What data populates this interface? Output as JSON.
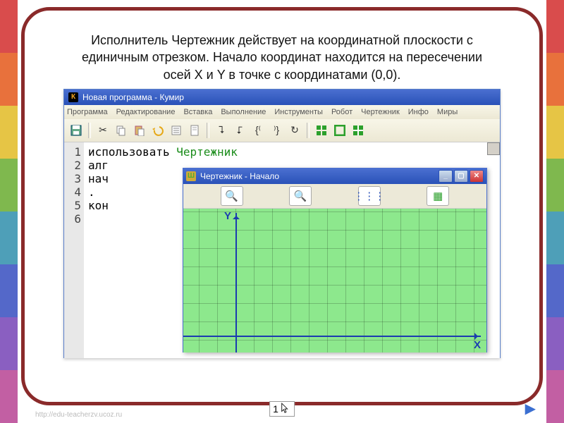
{
  "headline": "Исполнитель Чертежник действует на координатной плоскости с единичным отрезком. Начало координат находится на пересечении осей X и Y  в точке с координатами (0,0).",
  "kumir": {
    "title": "Новая программа - Кумир",
    "title_badge": "К",
    "menu": [
      "Программа",
      "Редактирование",
      "Вставка",
      "Выполнение",
      "Инструменты",
      "Робот",
      "Чертежник",
      "Инфо",
      "Миры"
    ],
    "code": {
      "line1a": "использовать ",
      "line1b": "Чертежник",
      "line2": "алг",
      "line3": "нач",
      "line4": ".",
      "line5": "кон",
      "gutters": [
        1,
        2,
        3,
        4,
        5,
        6
      ]
    }
  },
  "drawer": {
    "title": "Чертежник - Начало",
    "title_badge": "Ш",
    "x_label": "X",
    "y_label": "Y"
  },
  "cursor_label": "1",
  "footer": "http://edu-teacherzv.ucoz.ru"
}
